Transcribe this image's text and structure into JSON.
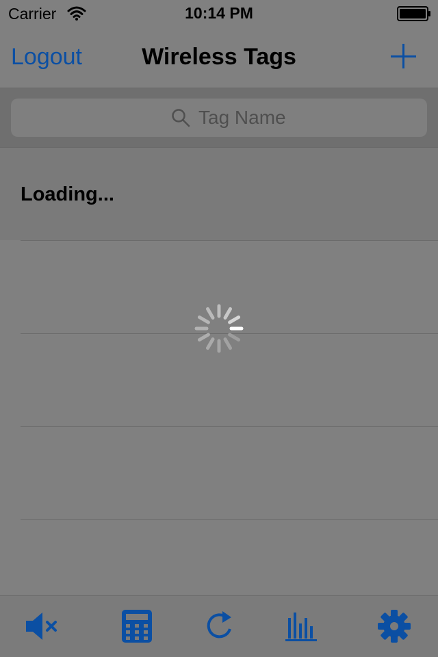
{
  "status_bar": {
    "carrier": "Carrier",
    "time": "10:14 PM"
  },
  "nav_bar": {
    "left_button": "Logout",
    "title": "Wireless Tags",
    "right_icon": "plus-icon"
  },
  "search": {
    "placeholder": "Tag Name"
  },
  "list": {
    "loading_text": "Loading..."
  },
  "tab_bar": {
    "items": [
      {
        "icon": "mute-icon"
      },
      {
        "icon": "calculator-icon"
      },
      {
        "icon": "refresh-icon"
      },
      {
        "icon": "bar-chart-icon"
      },
      {
        "icon": "gear-icon"
      }
    ]
  },
  "colors": {
    "accent": "#0b4fa3",
    "background": "#808080"
  }
}
